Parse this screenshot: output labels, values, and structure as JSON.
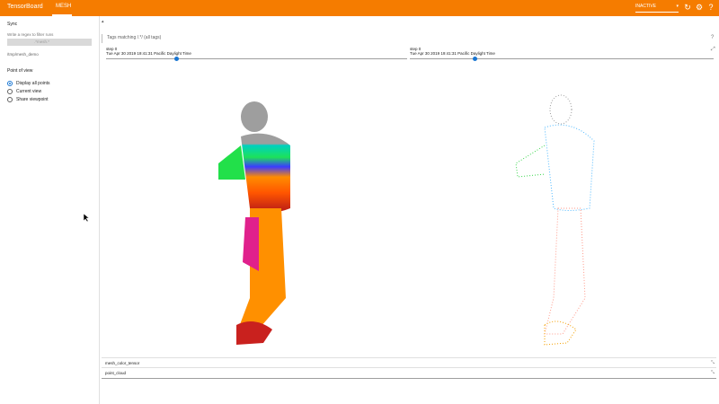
{
  "header": {
    "brand": "TensorBoard",
    "active_tab": "MESH",
    "run_selector": "INACTIVE"
  },
  "sidebar": {
    "sync_title": "Sync",
    "filter_label": "Write a regex to filter runs",
    "filter_input_value": ".*mesh.*",
    "run_item": "/tmp/mesh_demo",
    "point_of_view_title": "Point of view",
    "options": [
      "Display all points",
      "Current view",
      "Share viewpoint"
    ],
    "selected_option": "Display all points"
  },
  "main": {
    "tags_search": "Tags matching /.*/ (all tags)",
    "panels": [
      {
        "step": "step 0",
        "timestamp": "Tue Apr 30 2019 19:41:31 Pacific Daylight Time",
        "slider_value": 0.22
      },
      {
        "step": "step 0",
        "timestamp": "Tue Apr 30 2019 19:41:31 Pacific Daylight Time",
        "slider_value": 0.22
      }
    ],
    "cards": [
      "mesh_color_tensor",
      "point_cloud"
    ]
  },
  "colors": {
    "header": "#f57c00",
    "accent": "#1976d2"
  },
  "icons": [
    "refresh-icon",
    "gear-icon",
    "help-icon",
    "chevron-down-icon",
    "expand-icon"
  ]
}
